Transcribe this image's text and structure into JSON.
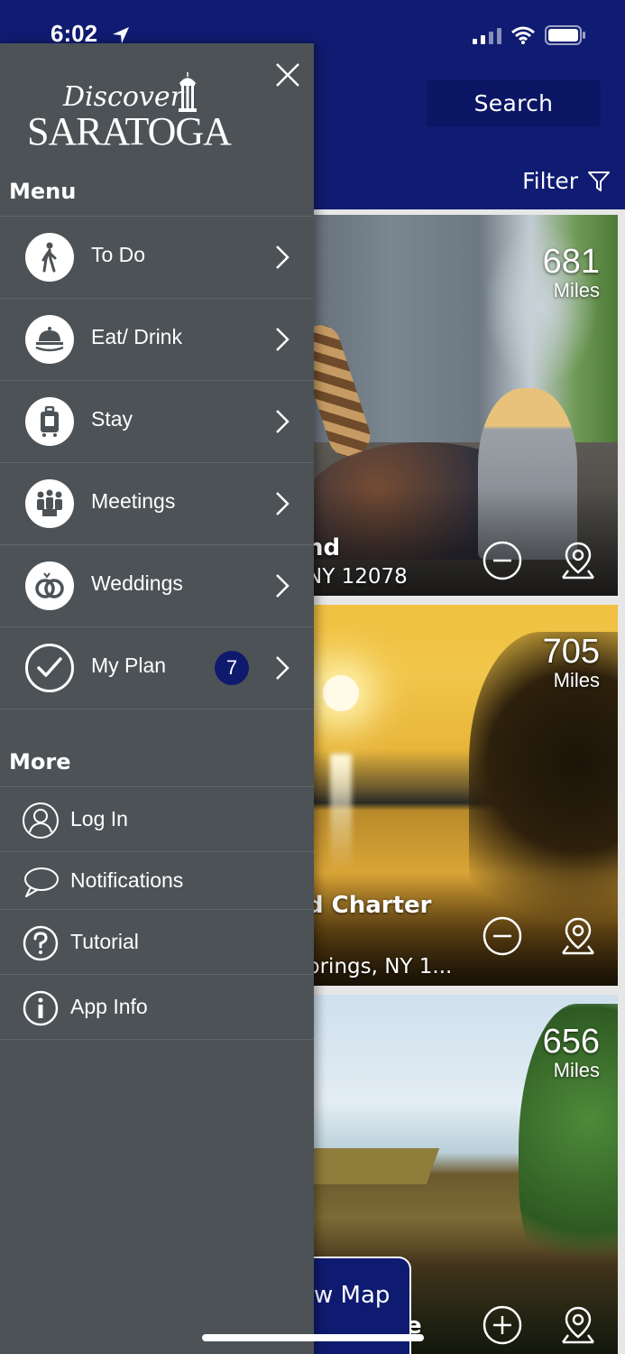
{
  "status_bar": {
    "time": "6:02"
  },
  "header": {
    "search_label": "Search",
    "filter_label": "Filter"
  },
  "cards": [
    {
      "miles": "681",
      "miles_unit": "Miles",
      "title_fragment": "nd",
      "subtitle_fragment": "NY 12078",
      "action_icon": "minus-circle-icon"
    },
    {
      "miles": "705",
      "miles_unit": "Miles",
      "title_fragment": "d Charter",
      "subtitle_fragment": "prings, NY 1...",
      "action_icon": "minus-circle-icon"
    },
    {
      "miles": "656",
      "miles_unit": "Miles",
      "title_fragment": "e",
      "action_icon": "plus-circle-icon"
    }
  ],
  "view_map": {
    "label_fragment": "w Map"
  },
  "drawer": {
    "logo": {
      "line1": "Discover",
      "line2": "SARATOGA"
    },
    "menu_title": "Menu",
    "menu_items": [
      {
        "label": "To Do",
        "icon": "walking-person-icon"
      },
      {
        "label": "Eat/ Drink",
        "icon": "cloche-icon"
      },
      {
        "label": "Stay",
        "icon": "luggage-icon"
      },
      {
        "label": "Meetings",
        "icon": "group-icon"
      },
      {
        "label": "Weddings",
        "icon": "rings-icon"
      },
      {
        "label": "My Plan",
        "icon": "check-circle-icon",
        "badge": "7"
      }
    ],
    "more_title": "More",
    "more_items": [
      {
        "label": "Log In",
        "icon": "user-icon"
      },
      {
        "label": "Notifications",
        "icon": "chat-bubble-icon"
      },
      {
        "label": "Tutorial",
        "icon": "question-icon"
      },
      {
        "label": "App Info",
        "icon": "info-icon"
      }
    ]
  }
}
